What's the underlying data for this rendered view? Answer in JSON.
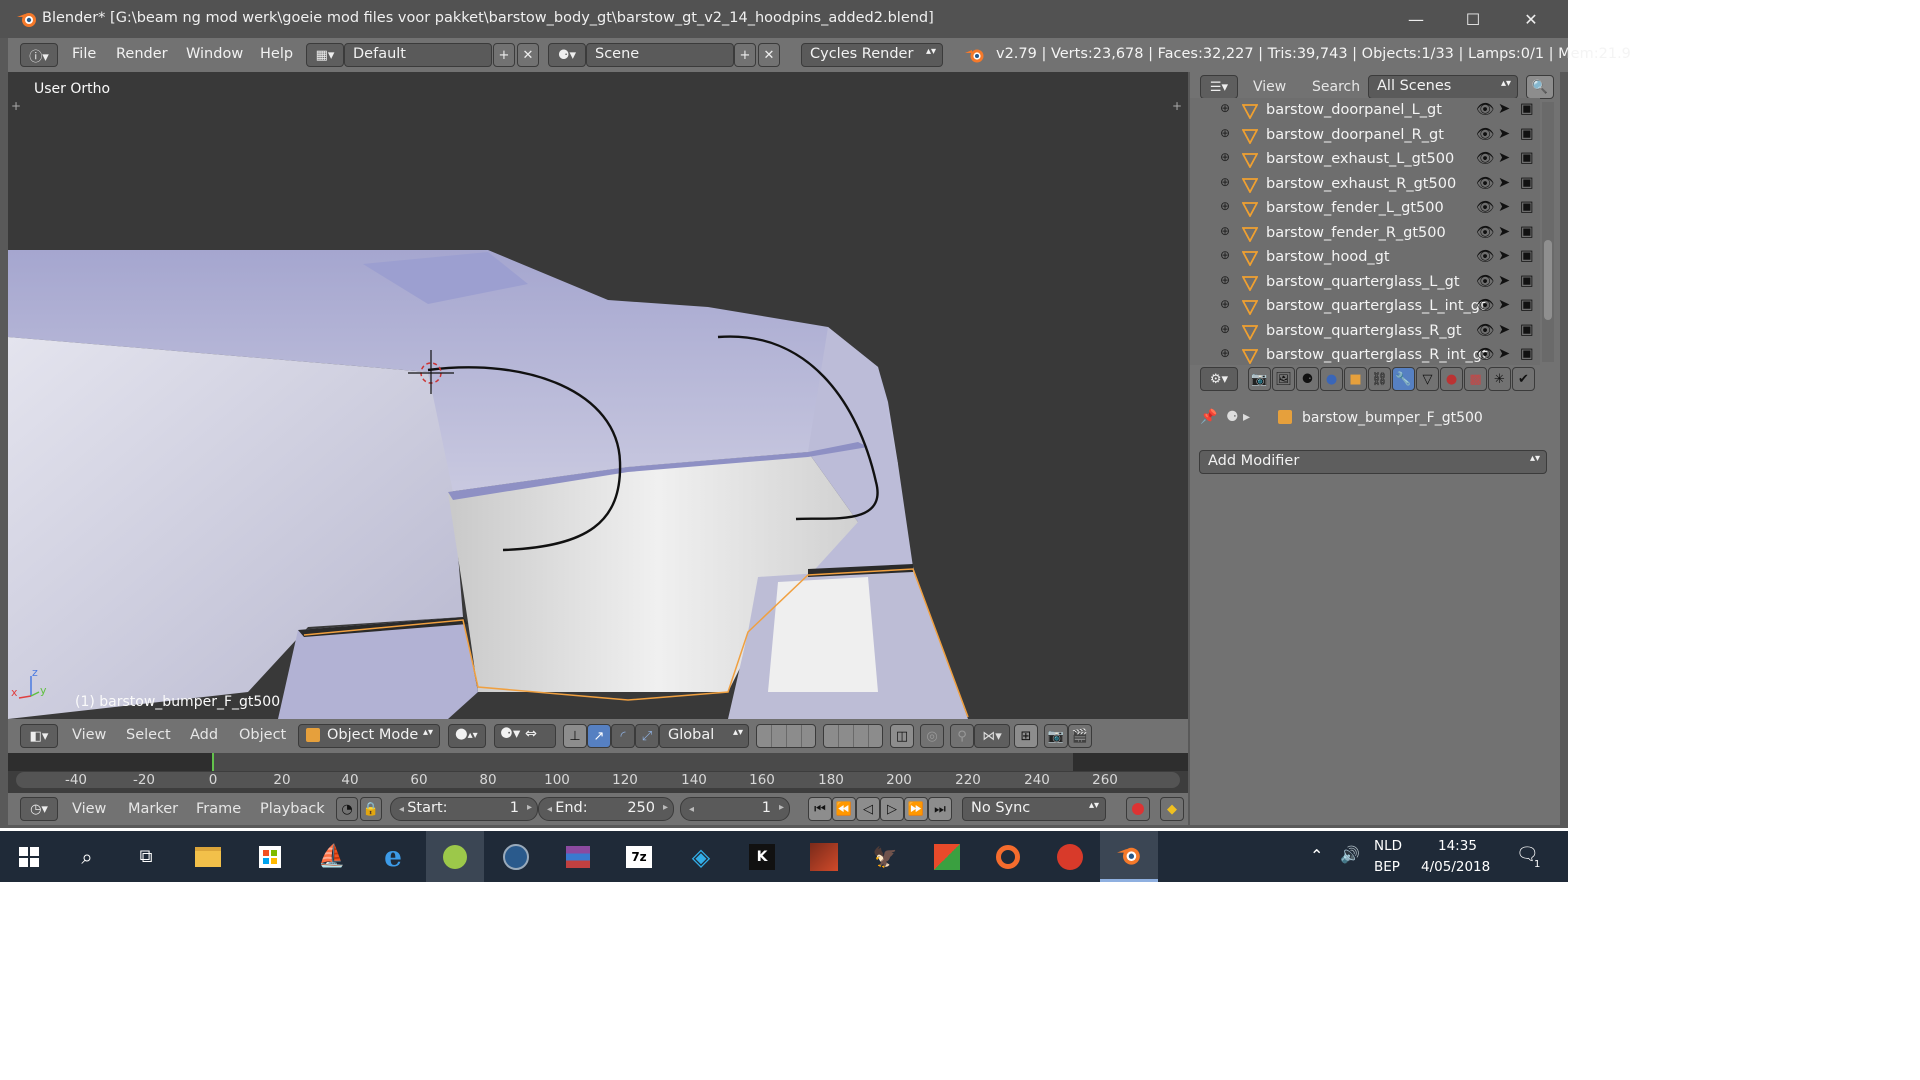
{
  "window": {
    "title": "Blender* [G:\\beam ng mod werk\\goeie mod files voor pakket\\barstow_body_gt\\barstow_gt_v2_14_hoodpins_added2.blend]",
    "controls": {
      "minimize": "—",
      "maximize": "☐",
      "close": "✕"
    }
  },
  "topbar": {
    "menus": [
      "File",
      "Render",
      "Window",
      "Help"
    ],
    "screen_layout": "Default",
    "scene": "Scene",
    "render_engine": "Cycles Render",
    "stats": "v2.79 | Verts:23,678 | Faces:32,227 | Tris:39,743 | Objects:1/33 | Lamps:0/1 | Mem:21.9"
  },
  "viewport": {
    "view_label": "User Ortho",
    "object_label": "(1) barstow_bumper_F_gt500",
    "axis": {
      "x": "x",
      "y": "y",
      "z": "z"
    }
  },
  "view3d_header": {
    "menus": [
      "View",
      "Select",
      "Add",
      "Object"
    ],
    "mode": "Object Mode",
    "orientation": "Global"
  },
  "timeline": {
    "ticks": [
      "-40",
      "-20",
      "0",
      "20",
      "40",
      "60",
      "80",
      "100",
      "120",
      "140",
      "160",
      "180",
      "200",
      "220",
      "240",
      "260"
    ],
    "current_frame_marker": "0"
  },
  "timeline_header": {
    "menus": [
      "View",
      "Marker",
      "Frame",
      "Playback"
    ],
    "start_label": "Start:",
    "start_value": "1",
    "end_label": "End:",
    "end_value": "250",
    "current_frame": "1",
    "sync": "No Sync"
  },
  "outliner": {
    "menus": [
      "View",
      "Search"
    ],
    "filter": "All Scenes",
    "items": [
      "barstow_doorpanel_L_gt",
      "barstow_doorpanel_R_gt",
      "barstow_exhaust_L_gt500",
      "barstow_exhaust_R_gt500",
      "barstow_fender_L_gt500",
      "barstow_fender_R_gt500",
      "barstow_hood_gt",
      "barstow_quarterglass_L_gt",
      "barstow_quarterglass_L_int_gt",
      "barstow_quarterglass_R_gt",
      "barstow_quarterglass_R_int_gt"
    ]
  },
  "properties": {
    "context_object": "barstow_bumper_F_gt500",
    "add_modifier": "Add Modifier"
  },
  "taskbar": {
    "language": "NLD",
    "layout": "BEP",
    "time": "14:35",
    "date": "4/05/2018",
    "notifications": "1",
    "apps": [
      "windows-start-icon",
      "search-icon",
      "task-view-icon",
      "file-explorer-icon",
      "store-icon",
      "corsair-icon",
      "internet-explorer-icon",
      "game-app-icon",
      "steam-icon",
      "winrar-icon",
      "7zip-icon",
      "kodi-icon",
      "k-app-icon",
      "max-payne-icon",
      "aorus-icon",
      "app-icon",
      "origin-icon",
      "ccleaner-icon",
      "blender-icon"
    ],
    "colors": {
      "taskbar": "#1f2a38",
      "accent": "#f5792a"
    }
  }
}
